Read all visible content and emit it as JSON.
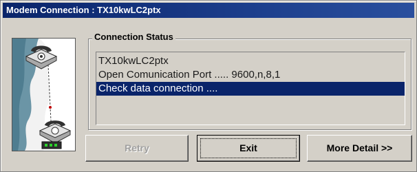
{
  "window": {
    "title": "Modem Connection : TX10kwLC2ptx"
  },
  "connection_status": {
    "label": "Connection Status",
    "lines": [
      "TX10kwLC2ptx",
      "Open Comunication Port ..... 9600,n,8,1",
      "Check data connection ...."
    ],
    "selected_index": 2
  },
  "buttons": {
    "retry": "Retry",
    "exit": "Exit",
    "more_detail": "More Detail >>"
  },
  "colors": {
    "title_bar": "#0a246a",
    "selection": "#0a246a",
    "dialog_face": "#d4d0c8"
  },
  "icons": [
    "telephone-icon",
    "telephone-icon",
    "network-icon"
  ]
}
